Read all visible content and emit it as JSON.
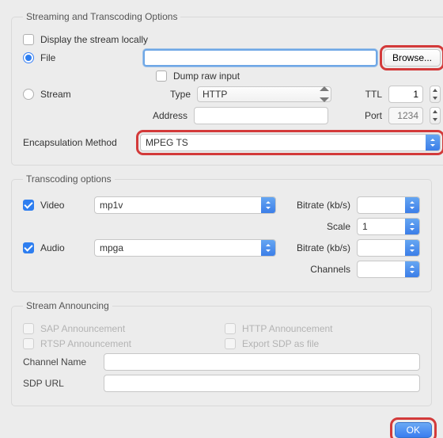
{
  "section1": {
    "title": "Streaming and Transcoding Options",
    "display_locally": "Display the stream locally",
    "file": "File",
    "file_value": "",
    "browse": "Browse...",
    "dump_raw": "Dump raw input",
    "stream": "Stream",
    "type": "Type",
    "type_value": "HTTP",
    "ttl": "TTL",
    "ttl_value": "1",
    "address": "Address",
    "address_value": "",
    "port": "Port",
    "port_placeholder": "1234",
    "encap": "Encapsulation Method",
    "encap_value": "MPEG TS"
  },
  "section2": {
    "title": "Transcoding options",
    "video": "Video",
    "video_codec": "mp1v",
    "bitrate": "Bitrate (kb/s)",
    "scale": "Scale",
    "scale_value": "1",
    "audio": "Audio",
    "audio_codec": "mpga",
    "channels": "Channels"
  },
  "section3": {
    "title": "Stream Announcing",
    "sap": "SAP Announcement",
    "rtsp": "RTSP Announcement",
    "http": "HTTP Announcement",
    "sdp": "Export SDP as file",
    "channel_name": "Channel Name",
    "sdp_url": "SDP URL"
  },
  "footer": {
    "ok": "OK"
  }
}
